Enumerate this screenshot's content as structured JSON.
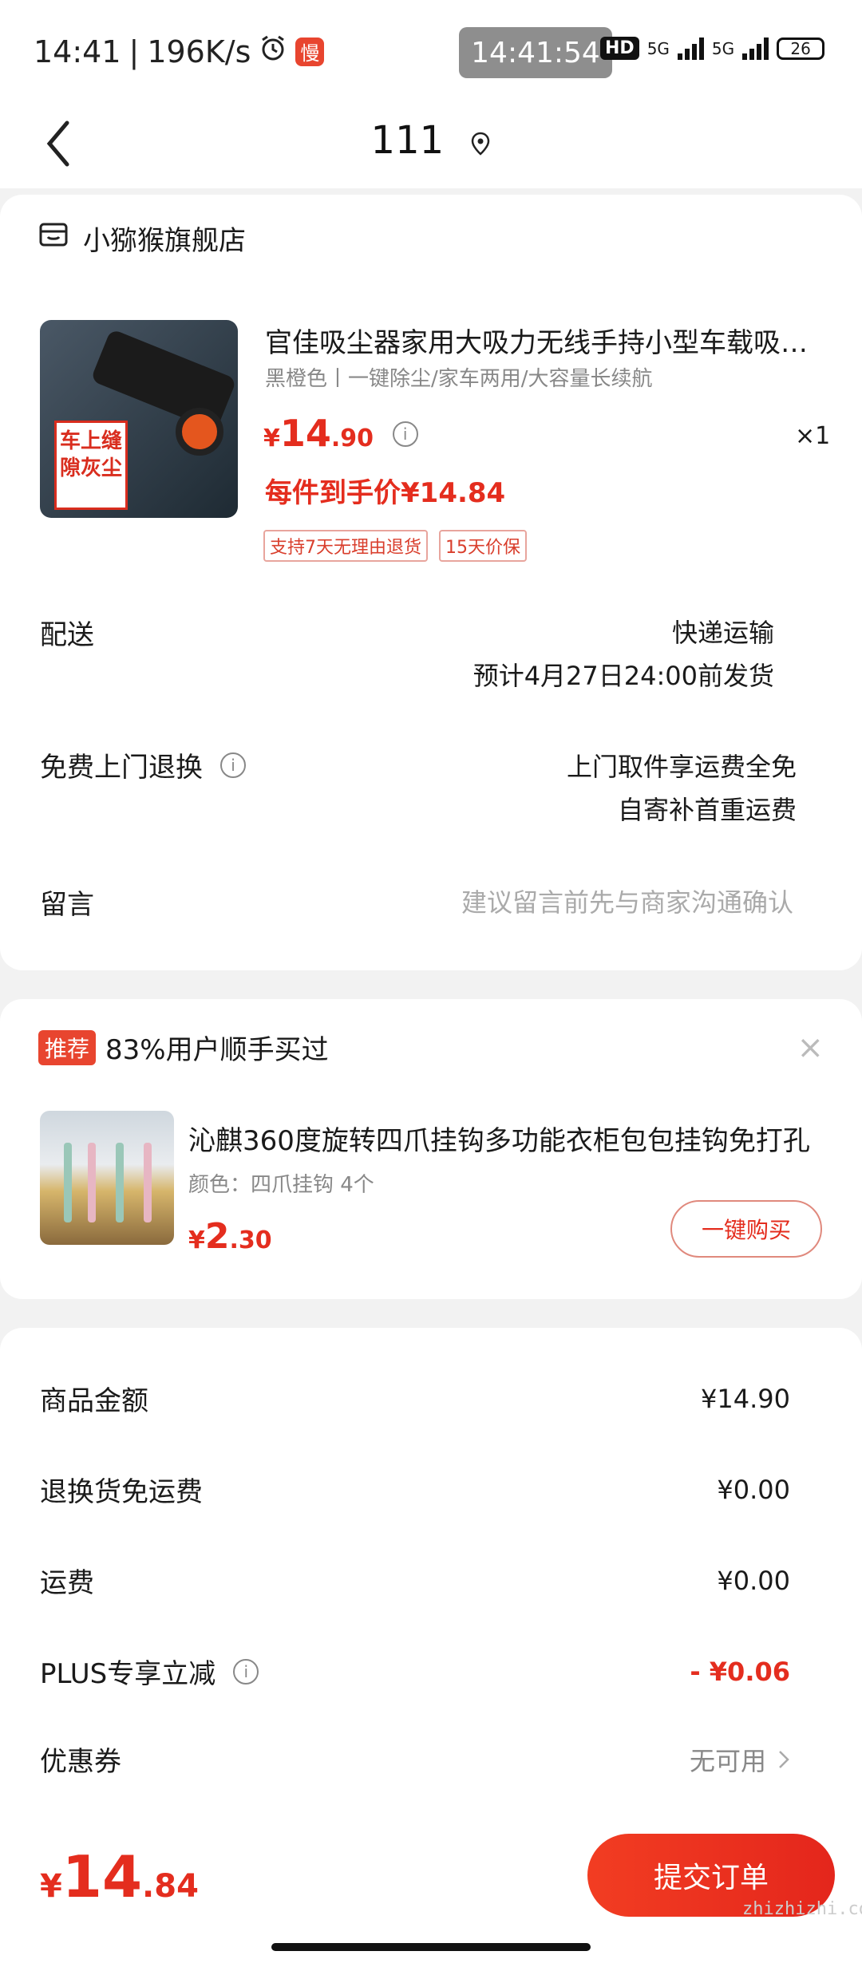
{
  "status": {
    "time": "14:41",
    "speed": "196K/s",
    "clock_overlay": "14:41:54",
    "hd": "HD",
    "net1": "5G",
    "net2": "5G",
    "battery": "26"
  },
  "nav": {
    "title": "111"
  },
  "store": {
    "name": "小猕猴旗舰店",
    "product": {
      "image_text": "车上缝隙灰尘",
      "title": "官佳吸尘器家用大吸力无线手持小型车载吸尘器",
      "spec": "黑橙色丨一键除尘/家车两用/大容量长续航",
      "price_symbol": "¥",
      "price_int": "14",
      "price_dec": ".90",
      "qty": "×1",
      "deal": "每件到手价¥14.84",
      "tags": [
        "支持7天无理由退货",
        "15天价保"
      ]
    },
    "delivery": {
      "label": "配送",
      "method": "快递运输",
      "eta": "预计4月27日24:00前发货"
    },
    "returns": {
      "label": "免费上门退换",
      "line1": "上门取件享运费全免",
      "line2": "自寄补首重运费"
    },
    "note": {
      "label": "留言",
      "placeholder": "建议留言前先与商家沟通确认"
    }
  },
  "recommend": {
    "badge": "推荐",
    "headline": "83%用户顺手买过",
    "close": "×",
    "title": "沁麒360度旋转四爪挂钩多功能衣柜包包挂钩免打孔",
    "spec": "颜色：四爪挂钩 4个",
    "price_symbol": "¥",
    "price_int": "2",
    "price_dec": ".30",
    "button": "一键购买"
  },
  "summary": {
    "rows": [
      {
        "label": "商品金额",
        "value": "¥14.90"
      },
      {
        "label": "退换货免运费",
        "value": "¥0.00"
      },
      {
        "label": "运费",
        "value": "¥0.00"
      },
      {
        "label": "PLUS专享立减",
        "value": "- ¥0.06"
      },
      {
        "label": "优惠券",
        "value": "无可用"
      }
    ]
  },
  "footer": {
    "price_symbol": "¥",
    "price_int": "14",
    "price_dec": ".84",
    "submit": "提交订单",
    "watermark": "zhizhizhi.com"
  },
  "colors": {
    "accent": "#e42d1e",
    "brand": "#f23d22"
  }
}
